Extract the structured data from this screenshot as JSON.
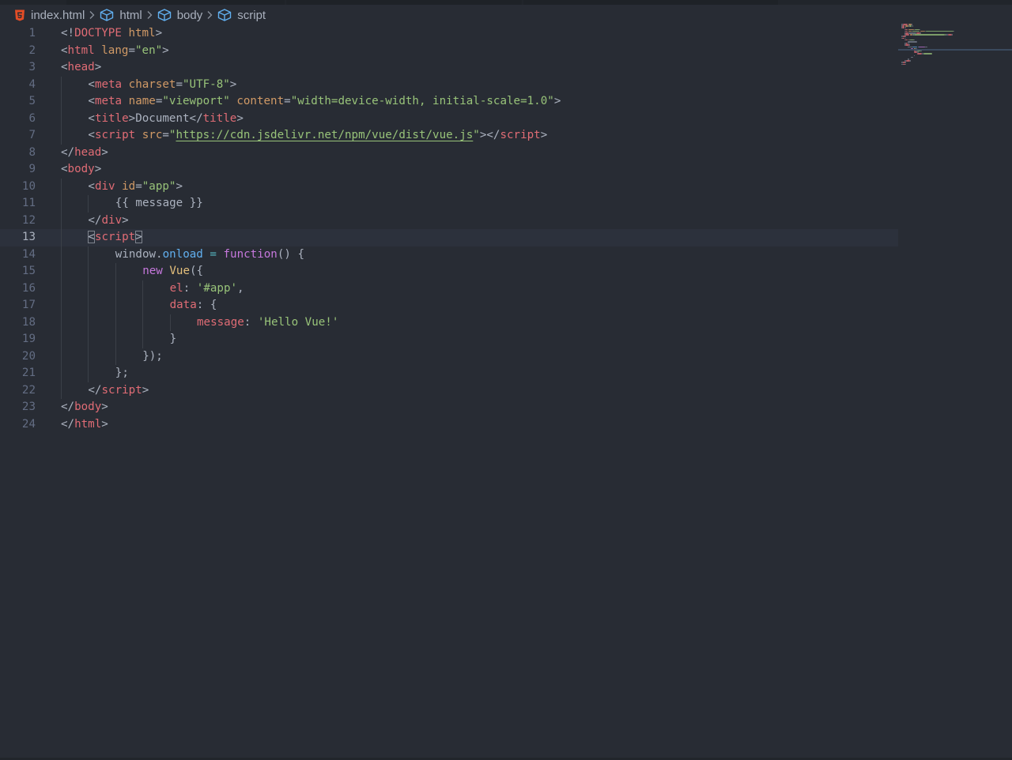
{
  "breadcrumb": {
    "file": "index.html",
    "items": [
      "html",
      "body",
      "script"
    ]
  },
  "colors": {
    "background": "#282c34",
    "tag": "#e06c75",
    "attribute": "#d19a66",
    "string": "#98c379",
    "keyword": "#c678dd",
    "property": "#61afef",
    "html_icon": "#e44d26",
    "symbol_icon": "#61afef"
  },
  "icons": {
    "file": "html5-file-icon",
    "element": "cube-icon",
    "separator": "chevron-right-icon"
  },
  "editor": {
    "current_line": 13,
    "lines": [
      {
        "n": "1",
        "indent": 0,
        "tokens": [
          [
            "punc",
            "<!"
          ],
          [
            "tag",
            "DOCTYPE"
          ],
          [
            "punc",
            " "
          ],
          [
            "attr",
            "html"
          ],
          [
            "punc",
            ">"
          ]
        ]
      },
      {
        "n": "2",
        "indent": 0,
        "tokens": [
          [
            "punc",
            "<"
          ],
          [
            "tag",
            "html"
          ],
          [
            "punc",
            " "
          ],
          [
            "attr",
            "lang"
          ],
          [
            "punc",
            "="
          ],
          [
            "str",
            "\"en\""
          ],
          [
            "punc",
            ">"
          ]
        ]
      },
      {
        "n": "3",
        "indent": 0,
        "tokens": [
          [
            "punc",
            "<"
          ],
          [
            "tag",
            "head"
          ],
          [
            "punc",
            ">"
          ]
        ]
      },
      {
        "n": "4",
        "indent": 1,
        "tokens": [
          [
            "punc",
            "<"
          ],
          [
            "tag",
            "meta"
          ],
          [
            "punc",
            " "
          ],
          [
            "attr",
            "charset"
          ],
          [
            "punc",
            "="
          ],
          [
            "str",
            "\"UTF-8\""
          ],
          [
            "punc",
            ">"
          ]
        ]
      },
      {
        "n": "5",
        "indent": 1,
        "tokens": [
          [
            "punc",
            "<"
          ],
          [
            "tag",
            "meta"
          ],
          [
            "punc",
            " "
          ],
          [
            "attr",
            "name"
          ],
          [
            "punc",
            "="
          ],
          [
            "str",
            "\"viewport\""
          ],
          [
            "punc",
            " "
          ],
          [
            "attr",
            "content"
          ],
          [
            "punc",
            "="
          ],
          [
            "str",
            "\"width=device-width, initial-scale=1.0\""
          ],
          [
            "punc",
            ">"
          ]
        ]
      },
      {
        "n": "6",
        "indent": 1,
        "tokens": [
          [
            "punc",
            "<"
          ],
          [
            "tag",
            "title"
          ],
          [
            "punc",
            ">Document</"
          ],
          [
            "tag",
            "title"
          ],
          [
            "punc",
            ">"
          ]
        ]
      },
      {
        "n": "7",
        "indent": 1,
        "tokens": [
          [
            "punc",
            "<"
          ],
          [
            "tag",
            "script"
          ],
          [
            "punc",
            " "
          ],
          [
            "attr",
            "src"
          ],
          [
            "punc",
            "="
          ],
          [
            "str",
            "\""
          ],
          [
            "url",
            "https://cdn.jsdelivr.net/npm/vue/dist/vue.js"
          ],
          [
            "str",
            "\""
          ],
          [
            "punc",
            "></"
          ],
          [
            "tag",
            "script"
          ],
          [
            "punc",
            ">"
          ]
        ]
      },
      {
        "n": "8",
        "indent": 0,
        "tokens": [
          [
            "punc",
            "</"
          ],
          [
            "tag",
            "head"
          ],
          [
            "punc",
            ">"
          ]
        ]
      },
      {
        "n": "9",
        "indent": 0,
        "tokens": [
          [
            "punc",
            "<"
          ],
          [
            "tag",
            "body"
          ],
          [
            "punc",
            ">"
          ]
        ]
      },
      {
        "n": "10",
        "indent": 1,
        "tokens": [
          [
            "punc",
            "<"
          ],
          [
            "tag",
            "div"
          ],
          [
            "punc",
            " "
          ],
          [
            "attr",
            "id"
          ],
          [
            "punc",
            "="
          ],
          [
            "str",
            "\"app\""
          ],
          [
            "punc",
            ">"
          ]
        ]
      },
      {
        "n": "11",
        "indent": 2,
        "tokens": [
          [
            "punc",
            "{{ message }}"
          ]
        ]
      },
      {
        "n": "12",
        "indent": 1,
        "tokens": [
          [
            "punc",
            "</"
          ],
          [
            "tag",
            "div"
          ],
          [
            "punc",
            ">"
          ]
        ]
      },
      {
        "n": "13",
        "indent": 1,
        "tokens": [
          [
            "bracket",
            "<"
          ],
          [
            "tag",
            "script"
          ],
          [
            "bracket",
            ">"
          ]
        ]
      },
      {
        "n": "14",
        "indent": 2,
        "tokens": [
          [
            "punc",
            "window."
          ],
          [
            "prop",
            "onload"
          ],
          [
            "punc",
            " "
          ],
          [
            "op",
            "="
          ],
          [
            "punc",
            " "
          ],
          [
            "fn",
            "function"
          ],
          [
            "punc",
            "() {"
          ]
        ]
      },
      {
        "n": "15",
        "indent": 3,
        "tokens": [
          [
            "kw",
            "new"
          ],
          [
            "punc",
            " "
          ],
          [
            "cls",
            "Vue"
          ],
          [
            "punc",
            "({"
          ]
        ]
      },
      {
        "n": "16",
        "indent": 4,
        "tokens": [
          [
            "key",
            "el"
          ],
          [
            "punc",
            ": "
          ],
          [
            "str",
            "'#app'"
          ],
          [
            "punc",
            ","
          ]
        ]
      },
      {
        "n": "17",
        "indent": 4,
        "tokens": [
          [
            "key",
            "data"
          ],
          [
            "punc",
            ": {"
          ]
        ]
      },
      {
        "n": "18",
        "indent": 5,
        "tokens": [
          [
            "key",
            "message"
          ],
          [
            "punc",
            ": "
          ],
          [
            "str",
            "'Hello Vue!'"
          ]
        ]
      },
      {
        "n": "19",
        "indent": 4,
        "tokens": [
          [
            "punc",
            "}"
          ]
        ]
      },
      {
        "n": "20",
        "indent": 3,
        "tokens": [
          [
            "punc",
            "});"
          ]
        ]
      },
      {
        "n": "21",
        "indent": 2,
        "tokens": [
          [
            "punc",
            "};"
          ]
        ]
      },
      {
        "n": "22",
        "indent": 1,
        "tokens": [
          [
            "punc",
            "</"
          ],
          [
            "tag",
            "script"
          ],
          [
            "punc",
            ">"
          ]
        ]
      },
      {
        "n": "23",
        "indent": 0,
        "tokens": [
          [
            "punc",
            "</"
          ],
          [
            "tag",
            "body"
          ],
          [
            "punc",
            ">"
          ]
        ]
      },
      {
        "n": "24",
        "indent": 0,
        "tokens": [
          [
            "punc",
            "</"
          ],
          [
            "tag",
            "html"
          ],
          [
            "punc",
            ">"
          ]
        ]
      }
    ]
  }
}
